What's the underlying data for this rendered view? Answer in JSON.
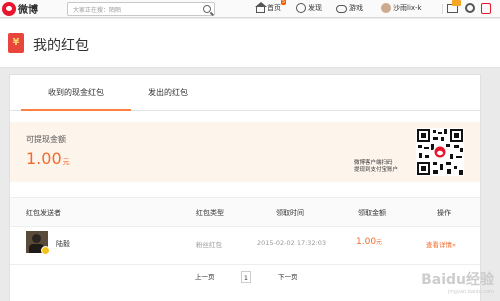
{
  "app": {
    "logo_text": "微博"
  },
  "search": {
    "placeholder": "大家正在搜：陌陌"
  },
  "nav": {
    "home": "首页",
    "home_badge": "5",
    "discover": "发现",
    "game": "游戏",
    "user": "沙雨lix-k"
  },
  "page": {
    "title": "我的红包"
  },
  "tabs": [
    {
      "label": "收到的现金红包",
      "active": true
    },
    {
      "label": "发出的红包",
      "active": false
    }
  ],
  "balance": {
    "label": "可提现金额",
    "amount": "1.00",
    "unit": "元",
    "qr_note_line1": "微博客户端扫码",
    "qr_note_line2": "提现到支付宝账户"
  },
  "table": {
    "headers": [
      "红包发送者",
      "红包类型",
      "领取时间",
      "领取金额",
      "操作"
    ],
    "rows": [
      {
        "sender": "陆毅",
        "type": "粉丝红包",
        "time": "2015-02-02 17:32:03",
        "amount": "1.00",
        "unit": "元",
        "action": "查看详情»"
      }
    ]
  },
  "pager": {
    "prev": "上一页",
    "current": "1",
    "next": "下一页"
  },
  "watermark": {
    "text": "Baidu经验",
    "sub": "jingyan.baidu.com"
  },
  "colors": {
    "accent": "#f46a2b",
    "brand": "#e6162d",
    "tab_underline": "#ff8140"
  }
}
